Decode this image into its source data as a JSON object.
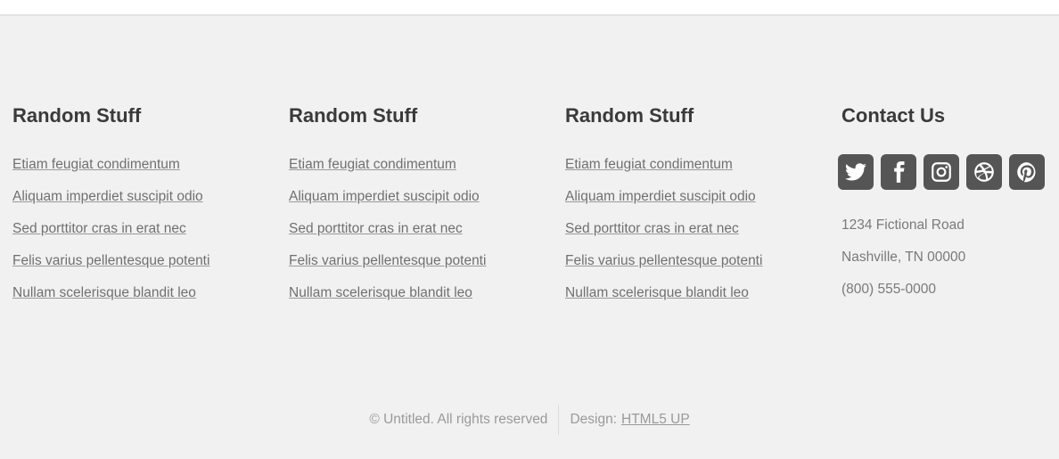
{
  "columns": [
    {
      "heading": "Random Stuff",
      "links": [
        "Etiam feugiat condimentum",
        "Aliquam imperdiet suscipit odio",
        "Sed porttitor cras in erat nec",
        "Felis varius pellentesque potenti",
        "Nullam scelerisque blandit leo"
      ]
    },
    {
      "heading": "Random Stuff",
      "links": [
        "Etiam feugiat condimentum",
        "Aliquam imperdiet suscipit odio",
        "Sed porttitor cras in erat nec",
        "Felis varius pellentesque potenti",
        "Nullam scelerisque blandit leo"
      ]
    },
    {
      "heading": "Random Stuff",
      "links": [
        "Etiam feugiat condimentum",
        "Aliquam imperdiet suscipit odio",
        "Sed porttitor cras in erat nec",
        "Felis varius pellentesque potenti",
        "Nullam scelerisque blandit leo"
      ]
    }
  ],
  "contact": {
    "heading": "Contact Us",
    "social_icons": [
      "twitter-icon",
      "facebook-icon",
      "instagram-icon",
      "dribbble-icon",
      "pinterest-icon"
    ],
    "address_lines": [
      "1234 Fictional Road",
      "Nashville, TN 00000",
      "(800) 555-0000"
    ]
  },
  "copyright": {
    "text": "© Untitled. All rights reserved",
    "design_label": "Design:",
    "design_link": "HTML5 UP"
  },
  "colors": {
    "background": "#f1f1f1",
    "heading": "#3a3a3a",
    "link": "#707070",
    "icon_bg": "#555555"
  }
}
